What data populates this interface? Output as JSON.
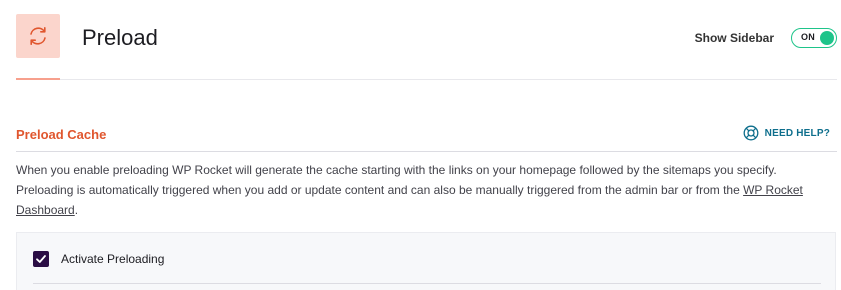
{
  "header": {
    "title": "Preload",
    "icon": "refresh-icon",
    "show_sidebar_label": "Show Sidebar",
    "sidebar_toggle_state": "ON"
  },
  "section": {
    "title": "Preload Cache",
    "help_label": "NEED HELP?",
    "help_icon": "lifebuoy-icon",
    "description_text": "When you enable preloading WP Rocket will generate the cache starting with the links on your homepage followed by the sitemaps you specify. Preloading is automatically triggered when you add or update content and can also be manually triggered from the admin bar or from the ",
    "description_link": "WP Rocket Dashboard",
    "description_end": "."
  },
  "options": {
    "activate_preloading_label": "Activate Preloading",
    "activate_preloading_checked": true
  },
  "colors": {
    "accent": "#e0562e",
    "icon_bg": "#fbd5cc",
    "toggle_on": "#1ec48a",
    "help_link": "#0d6e8c",
    "checkbox": "#2a0d44"
  }
}
